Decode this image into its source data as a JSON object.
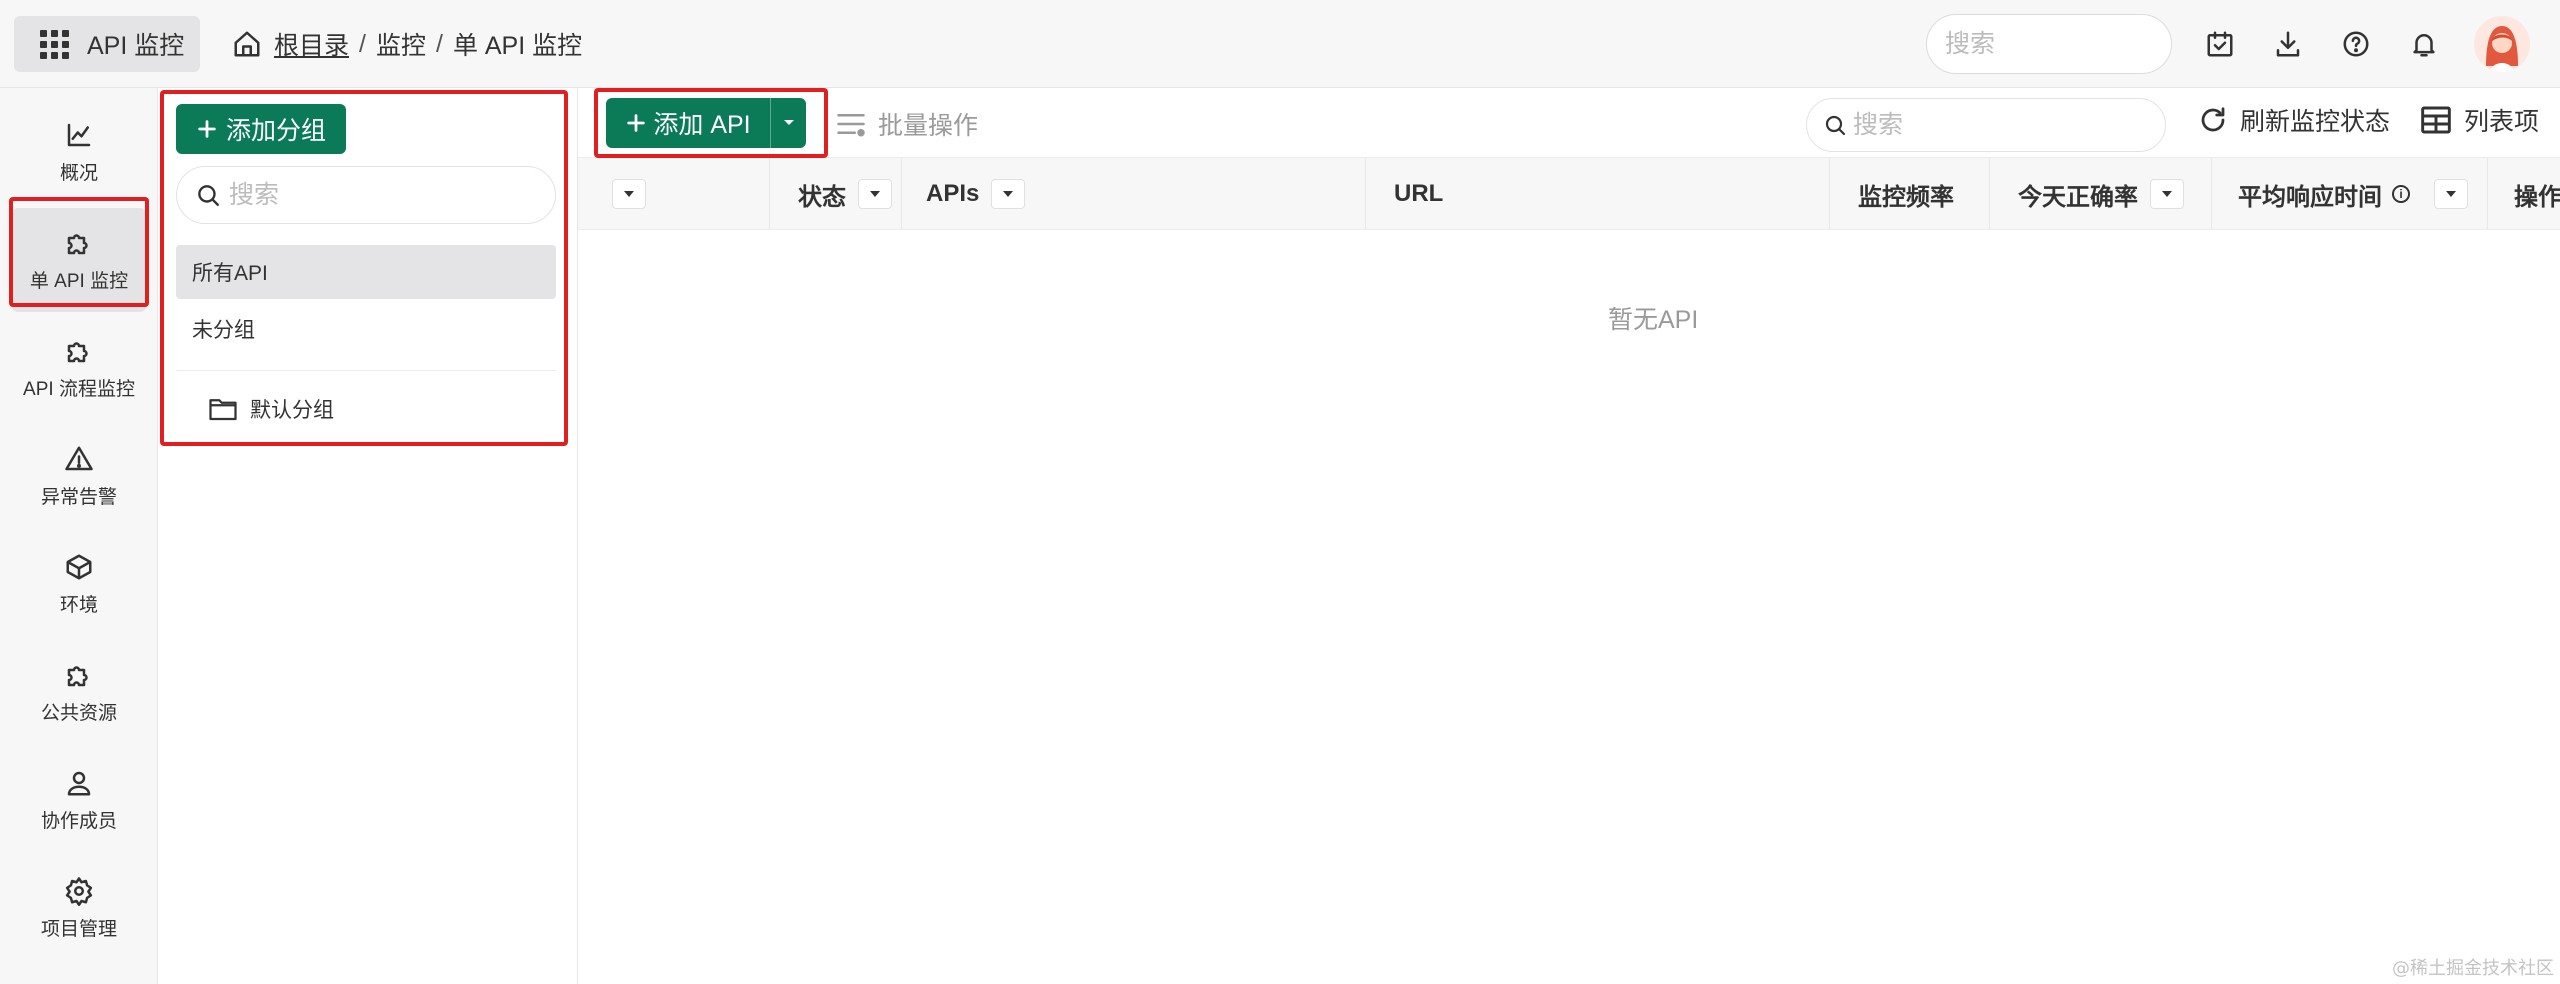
{
  "topbar": {
    "app_name": "API 监控",
    "breadcrumb": {
      "root": "根目录",
      "sep": "/",
      "monitor": "监控",
      "current": "单 API 监控"
    },
    "search_placeholder": "搜索"
  },
  "nav": {
    "items": [
      {
        "label": "概况",
        "icon": "chart-line-icon"
      },
      {
        "label": "单 API 监控",
        "icon": "puzzle-icon",
        "active": true
      },
      {
        "label": "API 流程监控",
        "icon": "puzzle-icon"
      },
      {
        "label": "异常告警",
        "icon": "warning-icon"
      },
      {
        "label": "环境",
        "icon": "cube-icon"
      },
      {
        "label": "公共资源",
        "icon": "puzzle-icon"
      },
      {
        "label": "协作成员",
        "icon": "user-group-icon"
      },
      {
        "label": "项目管理",
        "icon": "gear-icon"
      }
    ]
  },
  "groups": {
    "add_label": "添加分组",
    "search_placeholder": "搜索",
    "all_label": "所有API",
    "ungrouped_label": "未分组",
    "default_folder": "默认分组"
  },
  "toolbar": {
    "add_api_label": "添加 API",
    "batch_label": "批量操作",
    "search_placeholder": "搜索",
    "refresh_label": "刷新监控状态",
    "columns_label": "列表项"
  },
  "table": {
    "columns": [
      "状态",
      "APIs",
      "URL",
      "监控频率",
      "今天正确率",
      "平均响应时间",
      "操作"
    ],
    "empty_text": "暂无API"
  },
  "watermark": "@稀土掘金技术社区",
  "colors": {
    "primary": "#0b7a57",
    "highlight_border": "#e02020"
  }
}
